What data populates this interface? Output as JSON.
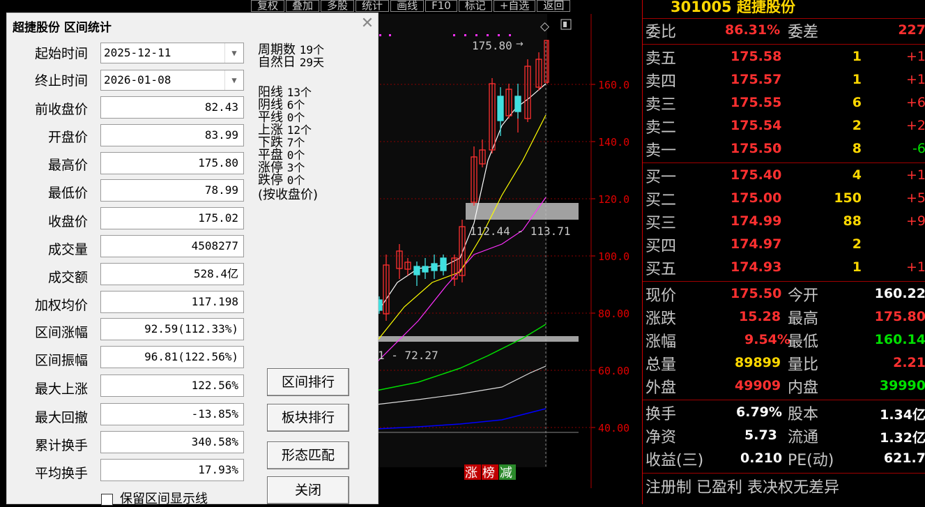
{
  "toolbar": [
    "复权",
    "叠加",
    "多股",
    "统计",
    "画线",
    "F10",
    "标记",
    "+自选",
    "返回"
  ],
  "chart": {
    "price_ticks": [
      "160.0",
      "140.0",
      "120.0",
      "100.0",
      "80.00",
      "60.00",
      "40.00"
    ],
    "high_label": "175.80",
    "range_label_1": "112.44 - 113.71",
    "range_label_2": "1 - 72.27",
    "badge_zhang": "涨",
    "badge_bang": "榜",
    "badge_jian": "减"
  },
  "dialog": {
    "title": "超捷股份 区间统计",
    "start_label": "起始时间",
    "start_value": "2025-12-11",
    "end_label": "终止时间",
    "end_value": "2026-01-08",
    "fields": [
      {
        "label": "前收盘价",
        "value": "82.43"
      },
      {
        "label": "开盘价",
        "value": "83.99"
      },
      {
        "label": "最高价",
        "value": "175.80"
      },
      {
        "label": "最低价",
        "value": "78.99"
      },
      {
        "label": "收盘价",
        "value": "175.02"
      },
      {
        "label": "成交量",
        "value": "4508277"
      },
      {
        "label": "成交额",
        "value": "528.4亿"
      },
      {
        "label": "加权均价",
        "value": "117.198"
      },
      {
        "label": "区间涨幅",
        "value": "92.59(112.33%)"
      },
      {
        "label": "区间振幅",
        "value": "96.81(122.56%)"
      },
      {
        "label": "最大上涨",
        "value": "122.56%"
      },
      {
        "label": "最大回撤",
        "value": "-13.85%"
      },
      {
        "label": "累计换手",
        "value": "340.58%"
      },
      {
        "label": "平均换手",
        "value": "17.93%"
      }
    ],
    "stats": {
      "period_label": "周期数",
      "period_value": "19个",
      "natural_label": "自然日",
      "natural_value": "29天",
      "yang_label": "阳线",
      "yang_value": "13个",
      "yin_label": "阴线",
      "yin_value": "6个",
      "flat_label": "平线",
      "flat_value": "0个",
      "up_label": "上涨",
      "up_value": "12个",
      "down_label": "下跌",
      "down_value": "7个",
      "flatclose_label": "平盘",
      "flatclose_value": "0个",
      "limitup_label": "涨停",
      "limitup_value": "3个",
      "limitdown_label": "跌停",
      "limitdown_value": "0个",
      "note": "(按收盘价)"
    },
    "buttons": {
      "rank": "区间排行",
      "sector": "板块排行",
      "pattern": "形态匹配",
      "close": "关闭"
    },
    "keep_line": "保留区间显示线"
  },
  "quote": {
    "title": "301005 超捷股份",
    "weibi_label": "委比",
    "weibi_value": "86.31%",
    "weicha_label": "委差",
    "weicha_value": "227",
    "asks": [
      {
        "label": "卖五",
        "price": "175.58",
        "vol": "1",
        "chg": "+1"
      },
      {
        "label": "卖四",
        "price": "175.57",
        "vol": "1",
        "chg": "+1"
      },
      {
        "label": "卖三",
        "price": "175.55",
        "vol": "6",
        "chg": "+6"
      },
      {
        "label": "卖二",
        "price": "175.54",
        "vol": "2",
        "chg": "+2"
      },
      {
        "label": "卖一",
        "price": "175.50",
        "vol": "8",
        "chg": "-6"
      }
    ],
    "bids": [
      {
        "label": "买一",
        "price": "175.40",
        "vol": "4",
        "chg": "+1"
      },
      {
        "label": "买二",
        "price": "175.00",
        "vol": "150",
        "chg": "+5"
      },
      {
        "label": "买三",
        "price": "174.99",
        "vol": "88",
        "chg": "+9"
      },
      {
        "label": "买四",
        "price": "174.97",
        "vol": "2",
        "chg": ""
      },
      {
        "label": "买五",
        "price": "174.93",
        "vol": "1",
        "chg": "+1"
      }
    ],
    "stats1": [
      {
        "l1": "现价",
        "v1": "175.50",
        "l2": "今开",
        "v2": "160.22"
      },
      {
        "l1": "涨跌",
        "v1": "15.28",
        "l2": "最高",
        "v2": "175.80"
      },
      {
        "l1": "涨幅",
        "v1": "9.54%",
        "l2": "最低",
        "v2": "160.14"
      },
      {
        "l1": "总量",
        "v1": "89899",
        "l2": "量比",
        "v2": "2.21"
      },
      {
        "l1": "外盘",
        "v1": "49909",
        "l2": "内盘",
        "v2": "39990"
      }
    ],
    "stats2": [
      {
        "l1": "换手",
        "v1": "6.79%",
        "l2": "股本",
        "v2": "1.34亿"
      },
      {
        "l1": "净资",
        "v1": "5.73",
        "l2": "流通",
        "v2": "1.32亿"
      },
      {
        "l1": "收益(三)",
        "v1": "0.210",
        "l2": "PE(动)",
        "v2": "621.7"
      }
    ],
    "tags": "注册制 已盈利 表决权无差异"
  }
}
